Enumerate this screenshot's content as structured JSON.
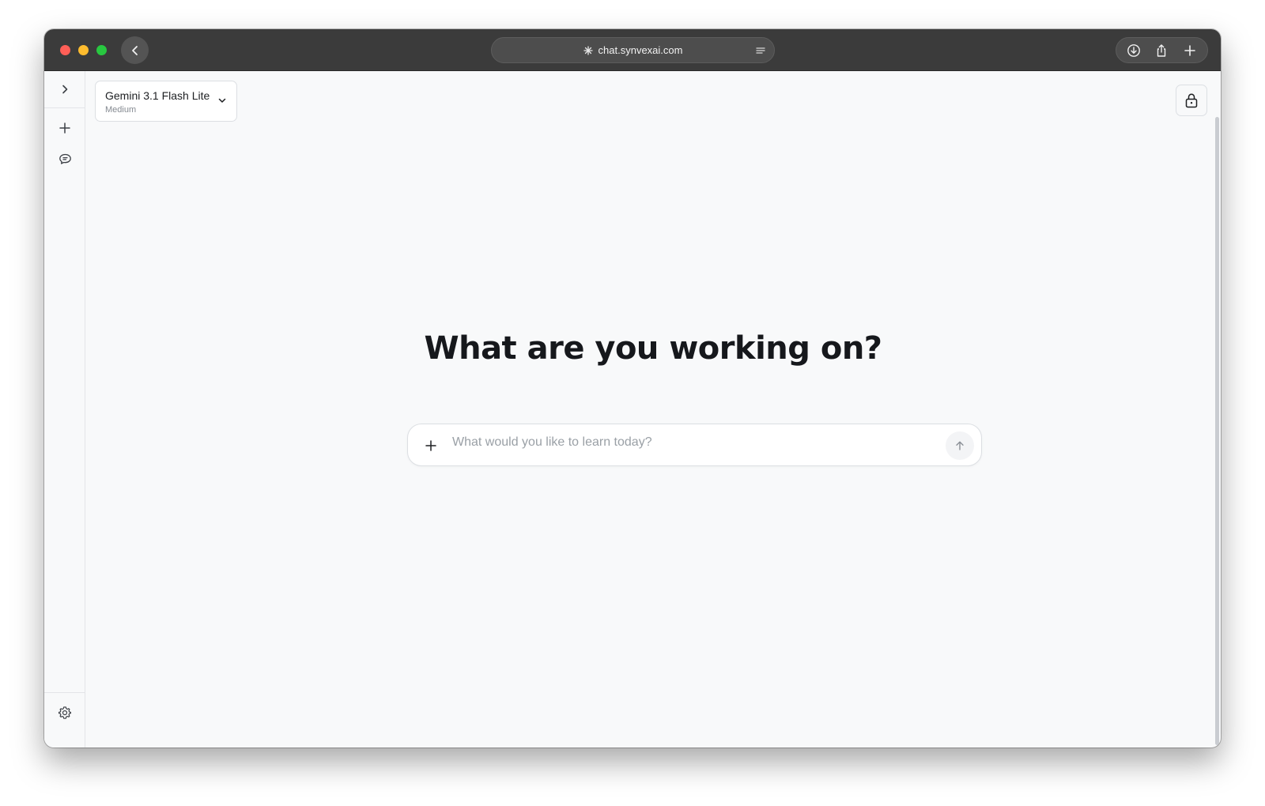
{
  "browser": {
    "url": "chat.synvexai.com"
  },
  "model_selector": {
    "name": "Gemini 3.1 Flash Lite",
    "level": "Medium"
  },
  "main": {
    "headline": "What are you working on?"
  },
  "composer": {
    "placeholder": "What would you like to learn today?",
    "value": ""
  },
  "icons": {
    "back": "chevron-left-icon",
    "site": "asterisk-icon",
    "reader": "reader-lines-icon",
    "download": "download-icon",
    "share": "share-icon",
    "new_tab": "plus-icon",
    "sidebar_expand": "chevron-right-icon",
    "new_chat": "plus-icon",
    "chat_history": "chat-bubble-icon",
    "settings": "gear-icon",
    "lock": "lock-icon",
    "attach": "plus-icon",
    "send": "arrow-up-icon"
  },
  "colors": {
    "titlebar": "#3b3b3b",
    "page_background": "#f8f9fa",
    "headline_text": "#16181c",
    "traffic_red": "#ff5f57",
    "traffic_yellow": "#febc2e",
    "traffic_green": "#28c840"
  }
}
